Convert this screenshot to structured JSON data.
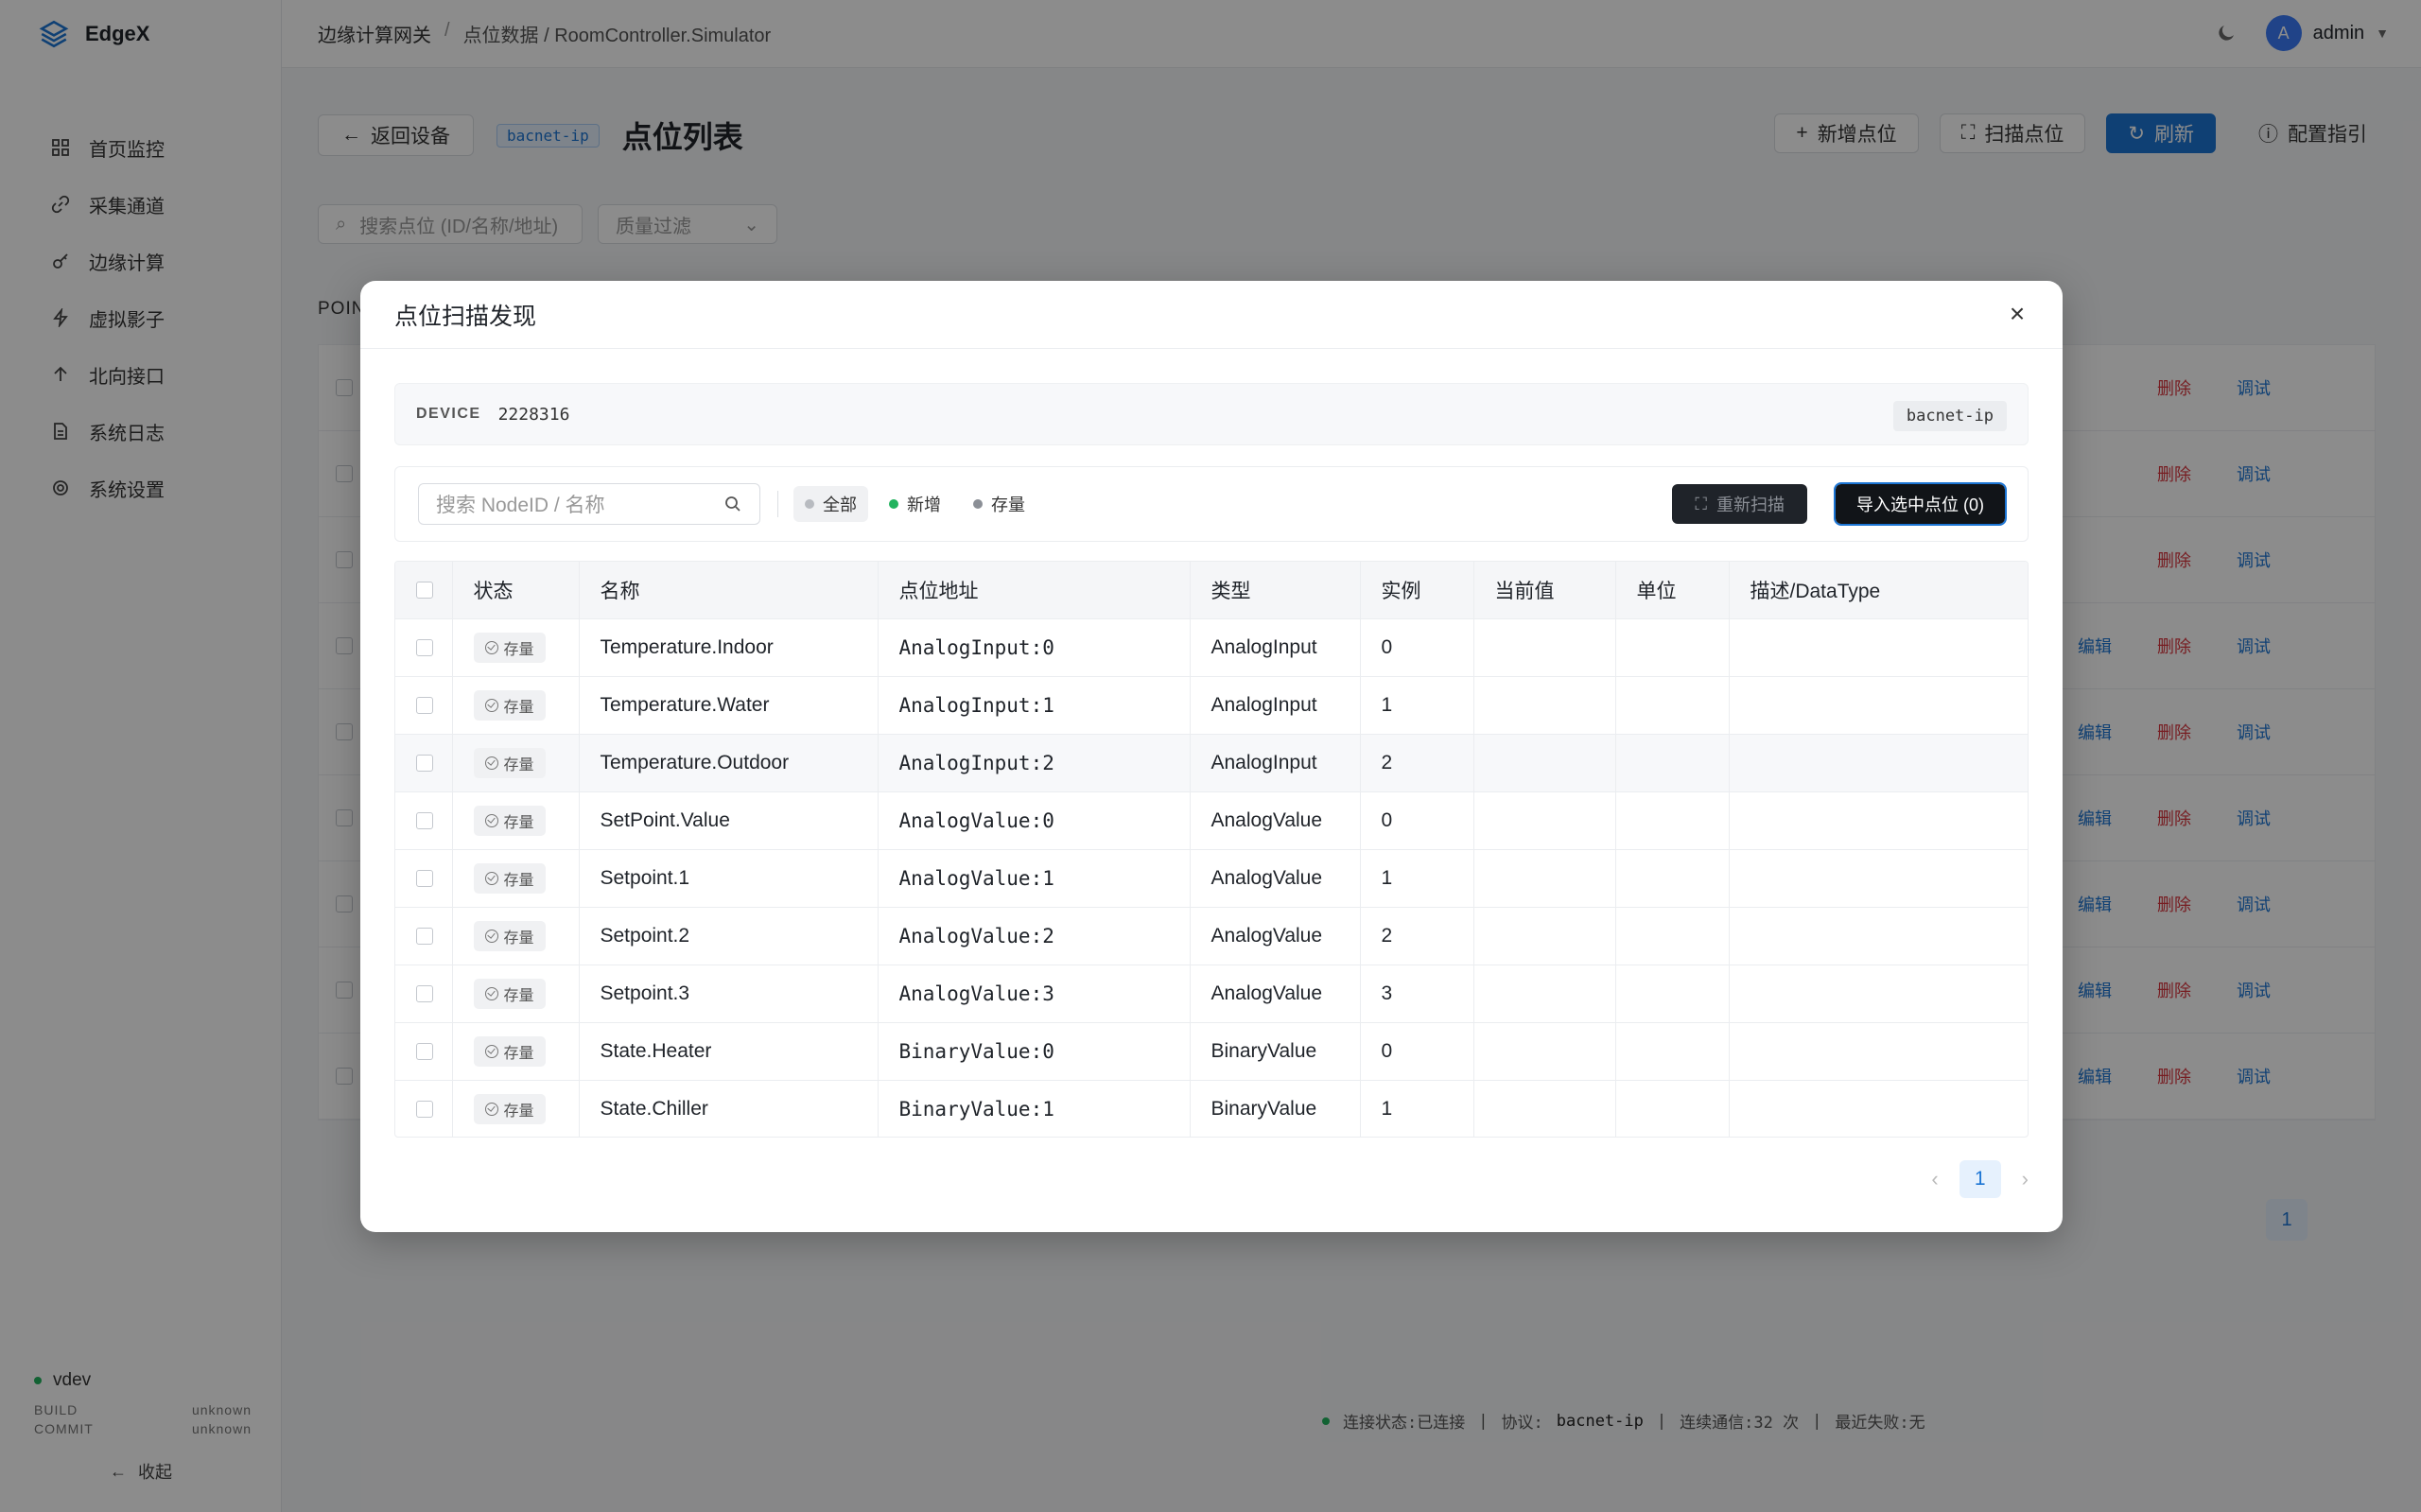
{
  "app": {
    "name": "EdgeX"
  },
  "breadcrumb": {
    "root": "边缘计算网关",
    "sep": "/",
    "current": "点位数据 / RoomController.Simulator"
  },
  "user": {
    "initial": "A",
    "name": "admin"
  },
  "sidebar": {
    "items": [
      {
        "label": "首页监控",
        "icon": "grid-icon"
      },
      {
        "label": "采集通道",
        "icon": "link-icon"
      },
      {
        "label": "边缘计算",
        "icon": "key-icon"
      },
      {
        "label": "虚拟影子",
        "icon": "bolt-icon"
      },
      {
        "label": "北向接口",
        "icon": "arrow-up-icon"
      },
      {
        "label": "系统日志",
        "icon": "doc-icon"
      },
      {
        "label": "系统设置",
        "icon": "gear-icon"
      }
    ],
    "env": "vdev",
    "build_label": "BUILD",
    "build_value": "unknown",
    "commit_label": "COMMIT",
    "commit_value": "unknown",
    "collapse": "收起"
  },
  "page": {
    "back": "返回设备",
    "protocol_tag": "bacnet-ip",
    "title": "点位列表",
    "actions": {
      "add": "新增点位",
      "scan": "扫描点位",
      "refresh": "刷新",
      "guide": "配置指引"
    },
    "search_placeholder": "搜索点位 (ID/名称/地址)",
    "quality_filter": "质量过滤",
    "section_label": "POIN",
    "row_actions": {
      "edit": "编辑",
      "delete": "删除",
      "debug": "调试"
    },
    "page_number": "1"
  },
  "status_bar": {
    "conn": "连接状态:已连接",
    "proto_label": "协议:",
    "proto": "bacnet-ip",
    "comm": "连续通信:32 次",
    "fail": "最近失败:无",
    "sep": "|"
  },
  "modal": {
    "title": "点位扫描发现",
    "close": "×",
    "device_label": "DEVICE",
    "device_id": "2228316",
    "device_protocol": "bacnet-ip",
    "search_placeholder": "搜索 NodeID / 名称",
    "filters": [
      {
        "label": "全部",
        "color": "#b8bbc0",
        "active": true
      },
      {
        "label": "新增",
        "color": "#22b35e",
        "active": false
      },
      {
        "label": "存量",
        "color": "#8b8f96",
        "active": false
      }
    ],
    "rescan": "重新扫描",
    "import": "导入选中点位 (0)",
    "columns": [
      "状态",
      "名称",
      "点位地址",
      "类型",
      "实例",
      "当前值",
      "单位",
      "描述/DataType"
    ],
    "rows": [
      {
        "status": "存量",
        "name": "Temperature.Indoor",
        "address": "AnalogInput:0",
        "type": "AnalogInput",
        "instance": "0",
        "value": "",
        "unit": "",
        "desc": ""
      },
      {
        "status": "存量",
        "name": "Temperature.Water",
        "address": "AnalogInput:1",
        "type": "AnalogInput",
        "instance": "1",
        "value": "",
        "unit": "",
        "desc": ""
      },
      {
        "status": "存量",
        "name": "Temperature.Outdoor",
        "address": "AnalogInput:2",
        "type": "AnalogInput",
        "instance": "2",
        "value": "",
        "unit": "",
        "desc": ""
      },
      {
        "status": "存量",
        "name": "SetPoint.Value",
        "address": "AnalogValue:0",
        "type": "AnalogValue",
        "instance": "0",
        "value": "",
        "unit": "",
        "desc": ""
      },
      {
        "status": "存量",
        "name": "Setpoint.1",
        "address": "AnalogValue:1",
        "type": "AnalogValue",
        "instance": "1",
        "value": "",
        "unit": "",
        "desc": ""
      },
      {
        "status": "存量",
        "name": "Setpoint.2",
        "address": "AnalogValue:2",
        "type": "AnalogValue",
        "instance": "2",
        "value": "",
        "unit": "",
        "desc": ""
      },
      {
        "status": "存量",
        "name": "Setpoint.3",
        "address": "AnalogValue:3",
        "type": "AnalogValue",
        "instance": "3",
        "value": "",
        "unit": "",
        "desc": ""
      },
      {
        "status": "存量",
        "name": "State.Heater",
        "address": "BinaryValue:0",
        "type": "BinaryValue",
        "instance": "0",
        "value": "",
        "unit": "",
        "desc": ""
      },
      {
        "status": "存量",
        "name": "State.Chiller",
        "address": "BinaryValue:1",
        "type": "BinaryValue",
        "instance": "1",
        "value": "",
        "unit": "",
        "desc": ""
      }
    ],
    "page_number": "1"
  }
}
